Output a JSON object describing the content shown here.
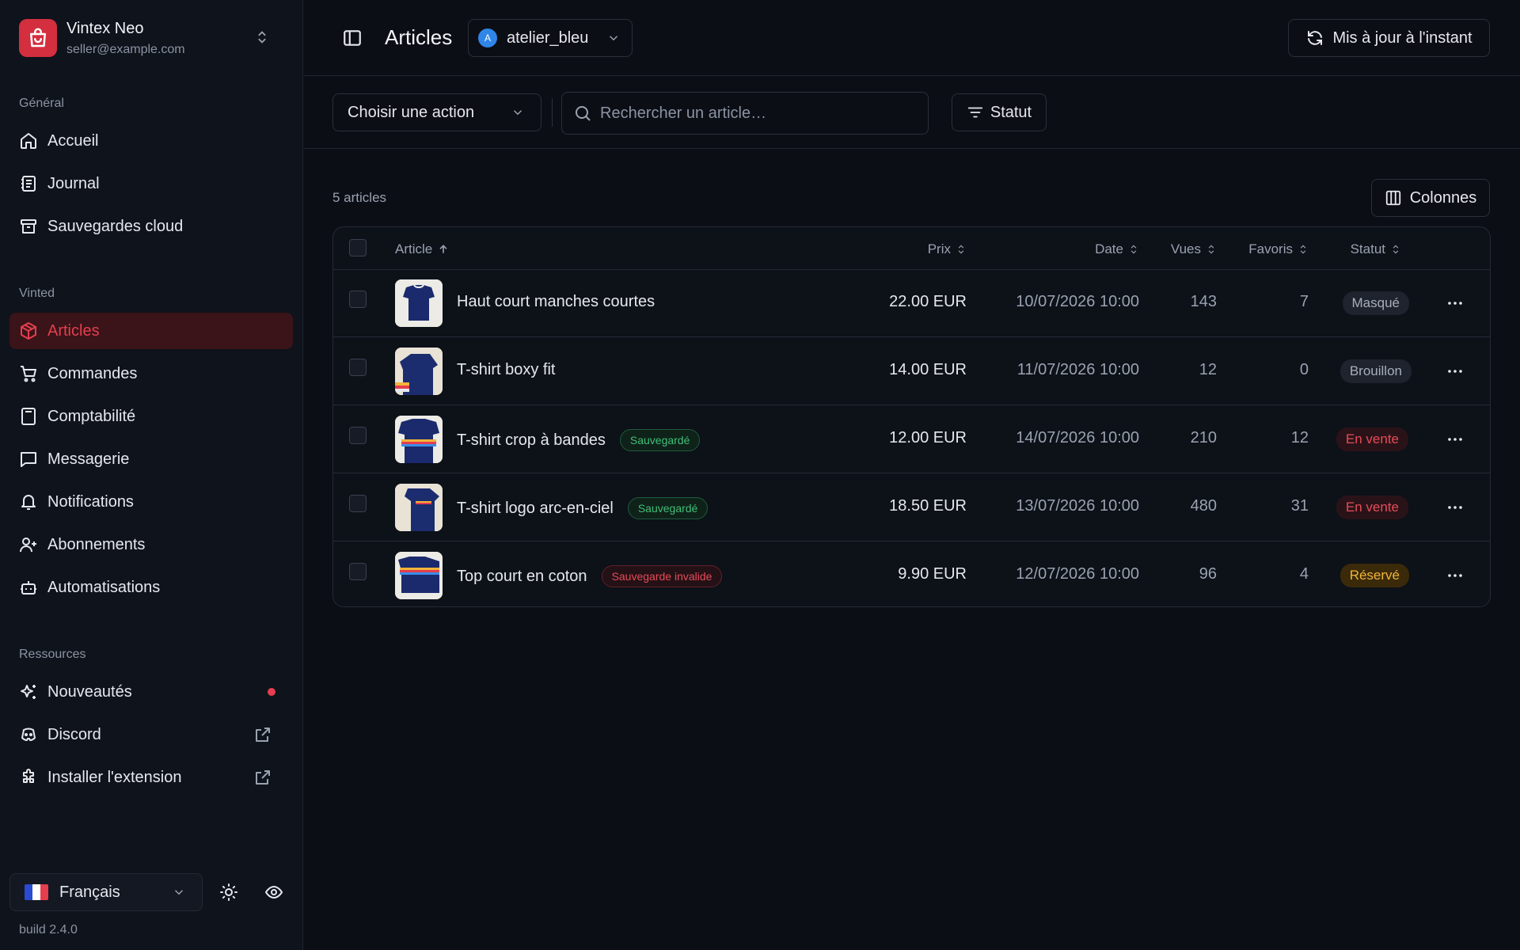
{
  "app": {
    "name": "Vintex Neo",
    "email": "seller@example.com",
    "build": "build 2.4.0"
  },
  "sidebar": {
    "sections": [
      {
        "title": "Général",
        "items": [
          {
            "label": "Accueil",
            "icon": "home-icon"
          },
          {
            "label": "Journal",
            "icon": "journal-icon"
          },
          {
            "label": "Sauvegardes cloud",
            "icon": "archive-icon"
          }
        ]
      },
      {
        "title": "Vinted",
        "items": [
          {
            "label": "Articles",
            "icon": "package-icon",
            "active": true
          },
          {
            "label": "Commandes",
            "icon": "cart-icon"
          },
          {
            "label": "Comptabilité",
            "icon": "calculator-icon"
          },
          {
            "label": "Messagerie",
            "icon": "message-icon"
          },
          {
            "label": "Notifications",
            "icon": "bell-icon"
          },
          {
            "label": "Abonnements",
            "icon": "user-plus-icon"
          },
          {
            "label": "Automatisations",
            "icon": "bot-icon"
          }
        ]
      },
      {
        "title": "Ressources",
        "items": [
          {
            "label": "Nouveautés",
            "icon": "sparkles-icon"
          },
          {
            "label": "Discord",
            "icon": "discord-icon"
          },
          {
            "label": "Installer l'extension",
            "icon": "puzzle-icon"
          }
        ]
      }
    ],
    "language": "Français"
  },
  "header": {
    "title": "Articles",
    "shop": "atelier_bleu",
    "shop_initial": "A",
    "refresh_label": "Mis à jour à l'instant"
  },
  "toolbar": {
    "action_label": "Choisir une action",
    "search_placeholder": "Rechercher un article…",
    "status_filter": "Statut"
  },
  "list": {
    "count_label": "5 articles",
    "columns_button": "Colonnes"
  },
  "table": {
    "headers": {
      "article": "Article",
      "price": "Prix",
      "date": "Date",
      "views": "Vues",
      "favs": "Favoris",
      "status": "Statut"
    },
    "rows": [
      {
        "name": "Haut court manches courtes",
        "tag": "",
        "price": "22.00 EUR",
        "date": "10/07/2026 10:00",
        "views": "143",
        "favs": "7",
        "status": "Masqué"
      },
      {
        "name": "T-shirt boxy fit",
        "tag": "",
        "price": "14.00 EUR",
        "date": "11/07/2026 10:00",
        "views": "12",
        "favs": "0",
        "status": "Brouillon"
      },
      {
        "name": "T-shirt crop à bandes",
        "tag": "Sauvegardé",
        "price": "12.00 EUR",
        "date": "14/07/2026 10:00",
        "views": "210",
        "favs": "12",
        "status": "En vente"
      },
      {
        "name": "T-shirt logo arc-en-ciel",
        "tag": "Sauvegardé",
        "price": "18.50 EUR",
        "date": "13/07/2026 10:00",
        "views": "480",
        "favs": "31",
        "status": "En vente"
      },
      {
        "name": "Top court en coton",
        "tag": "Sauvegarde invalide",
        "price": "9.90 EUR",
        "date": "12/07/2026 10:00",
        "views": "96",
        "favs": "4",
        "status": "Réservé"
      }
    ]
  },
  "colors": {
    "accent": "#e53e4f",
    "background": "#0b0e14",
    "sidebar": "#0f131b"
  }
}
